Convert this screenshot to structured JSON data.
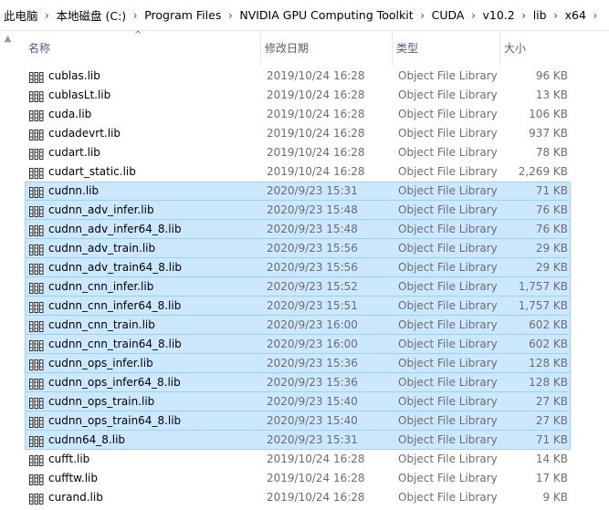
{
  "breadcrumb": [
    "此电脑",
    "本地磁盘 (C:)",
    "Program Files",
    "NVIDIA GPU Computing Toolkit",
    "CUDA",
    "v10.2",
    "lib",
    "x64"
  ],
  "breadcrumb_separator": "›",
  "columns": {
    "name": "名称",
    "date": "修改日期",
    "type": "类型",
    "size": "大小"
  },
  "selection_color": "#cce8ff",
  "files": [
    {
      "name": "cublas.lib",
      "date": "2019/10/24 16:28",
      "type": "Object File Library",
      "size": "96 KB",
      "selected": false
    },
    {
      "name": "cublasLt.lib",
      "date": "2019/10/24 16:28",
      "type": "Object File Library",
      "size": "13 KB",
      "selected": false
    },
    {
      "name": "cuda.lib",
      "date": "2019/10/24 16:28",
      "type": "Object File Library",
      "size": "106 KB",
      "selected": false
    },
    {
      "name": "cudadevrt.lib",
      "date": "2019/10/24 16:28",
      "type": "Object File Library",
      "size": "937 KB",
      "selected": false
    },
    {
      "name": "cudart.lib",
      "date": "2019/10/24 16:28",
      "type": "Object File Library",
      "size": "78 KB",
      "selected": false
    },
    {
      "name": "cudart_static.lib",
      "date": "2019/10/24 16:28",
      "type": "Object File Library",
      "size": "2,269 KB",
      "selected": false
    },
    {
      "name": "cudnn.lib",
      "date": "2020/9/23 15:31",
      "type": "Object File Library",
      "size": "71 KB",
      "selected": true
    },
    {
      "name": "cudnn_adv_infer.lib",
      "date": "2020/9/23 15:48",
      "type": "Object File Library",
      "size": "76 KB",
      "selected": true
    },
    {
      "name": "cudnn_adv_infer64_8.lib",
      "date": "2020/9/23 15:48",
      "type": "Object File Library",
      "size": "76 KB",
      "selected": true
    },
    {
      "name": "cudnn_adv_train.lib",
      "date": "2020/9/23 15:56",
      "type": "Object File Library",
      "size": "29 KB",
      "selected": true
    },
    {
      "name": "cudnn_adv_train64_8.lib",
      "date": "2020/9/23 15:56",
      "type": "Object File Library",
      "size": "29 KB",
      "selected": true
    },
    {
      "name": "cudnn_cnn_infer.lib",
      "date": "2020/9/23 15:52",
      "type": "Object File Library",
      "size": "1,757 KB",
      "selected": true
    },
    {
      "name": "cudnn_cnn_infer64_8.lib",
      "date": "2020/9/23 15:51",
      "type": "Object File Library",
      "size": "1,757 KB",
      "selected": true
    },
    {
      "name": "cudnn_cnn_train.lib",
      "date": "2020/9/23 16:00",
      "type": "Object File Library",
      "size": "602 KB",
      "selected": true
    },
    {
      "name": "cudnn_cnn_train64_8.lib",
      "date": "2020/9/23 16:00",
      "type": "Object File Library",
      "size": "602 KB",
      "selected": true
    },
    {
      "name": "cudnn_ops_infer.lib",
      "date": "2020/9/23 15:36",
      "type": "Object File Library",
      "size": "128 KB",
      "selected": true
    },
    {
      "name": "cudnn_ops_infer64_8.lib",
      "date": "2020/9/23 15:36",
      "type": "Object File Library",
      "size": "128 KB",
      "selected": true
    },
    {
      "name": "cudnn_ops_train.lib",
      "date": "2020/9/23 15:40",
      "type": "Object File Library",
      "size": "27 KB",
      "selected": true
    },
    {
      "name": "cudnn_ops_train64_8.lib",
      "date": "2020/9/23 15:40",
      "type": "Object File Library",
      "size": "27 KB",
      "selected": true
    },
    {
      "name": "cudnn64_8.lib",
      "date": "2020/9/23 15:31",
      "type": "Object File Library",
      "size": "71 KB",
      "selected": true
    },
    {
      "name": "cufft.lib",
      "date": "2019/10/24 16:28",
      "type": "Object File Library",
      "size": "14 KB",
      "selected": false
    },
    {
      "name": "cufftw.lib",
      "date": "2019/10/24 16:28",
      "type": "Object File Library",
      "size": "17 KB",
      "selected": false
    },
    {
      "name": "curand.lib",
      "date": "2019/10/24 16:28",
      "type": "Object File Library",
      "size": "9 KB",
      "selected": false
    }
  ]
}
